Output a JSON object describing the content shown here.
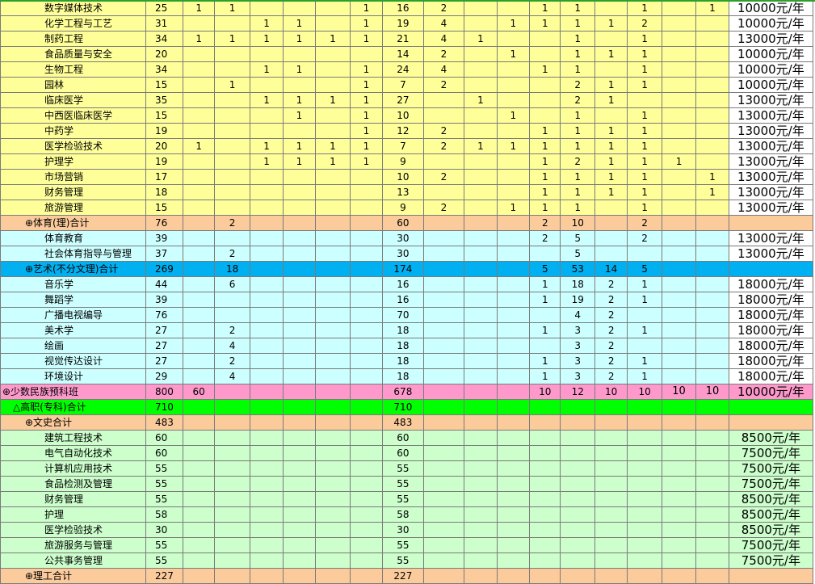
{
  "rows": [
    {
      "name": "数字媒体技术",
      "level": "item",
      "fill": "yellow",
      "cells": [
        "25",
        "1",
        "1",
        "",
        "",
        "",
        "1",
        "16",
        "2",
        "",
        "",
        "1",
        "1",
        "",
        "1",
        "",
        "1",
        "10000元/年"
      ],
      "fee_white": true
    },
    {
      "name": "化学工程与工艺",
      "level": "item",
      "fill": "yellow",
      "cells": [
        "31",
        "",
        "",
        "1",
        "1",
        "",
        "1",
        "19",
        "4",
        "",
        "1",
        "1",
        "1",
        "1",
        "2",
        "",
        "",
        "10000元/年"
      ],
      "fee_white": true
    },
    {
      "name": "制药工程",
      "level": "item",
      "fill": "yellow",
      "cells": [
        "34",
        "1",
        "1",
        "1",
        "1",
        "1",
        "1",
        "21",
        "4",
        "1",
        "",
        "",
        "1",
        "",
        "1",
        "",
        "",
        "13000元/年"
      ],
      "fee_white": true
    },
    {
      "name": "食品质量与安全",
      "level": "item",
      "fill": "yellow",
      "cells": [
        "20",
        "",
        "",
        "",
        "",
        "",
        "",
        "14",
        "2",
        "",
        "1",
        "",
        "1",
        "1",
        "1",
        "",
        "",
        "10000元/年"
      ],
      "fee_white": true
    },
    {
      "name": "生物工程",
      "level": "item",
      "fill": "yellow",
      "cells": [
        "34",
        "",
        "",
        "1",
        "1",
        "",
        "1",
        "24",
        "4",
        "",
        "",
        "1",
        "1",
        "",
        "1",
        "",
        "",
        "10000元/年"
      ],
      "fee_white": true
    },
    {
      "name": "园林",
      "level": "item",
      "fill": "yellow",
      "cells": [
        "15",
        "",
        "1",
        "",
        "",
        "",
        "1",
        "7",
        "2",
        "",
        "",
        "",
        "2",
        "1",
        "1",
        "",
        "",
        "10000元/年"
      ],
      "fee_white": true
    },
    {
      "name": "临床医学",
      "level": "item",
      "fill": "yellow",
      "cells": [
        "35",
        "",
        "",
        "1",
        "1",
        "1",
        "1",
        "27",
        "",
        "1",
        "",
        "",
        "2",
        "1",
        "",
        "",
        "",
        "13000元/年"
      ],
      "fee_white": true
    },
    {
      "name": "中西医临床医学",
      "level": "item",
      "fill": "yellow",
      "cells": [
        "15",
        "",
        "",
        "",
        "1",
        "",
        "1",
        "10",
        "",
        "",
        "1",
        "",
        "1",
        "",
        "1",
        "",
        "",
        "13000元/年"
      ],
      "fee_white": true
    },
    {
      "name": "中药学",
      "level": "item",
      "fill": "yellow",
      "cells": [
        "19",
        "",
        "",
        "",
        "",
        "",
        "1",
        "12",
        "2",
        "",
        "",
        "1",
        "1",
        "1",
        "1",
        "",
        "",
        "13000元/年"
      ],
      "fee_white": true
    },
    {
      "name": "医学检验技术",
      "level": "item",
      "fill": "yellow",
      "cells": [
        "20",
        "1",
        "",
        "1",
        "1",
        "1",
        "1",
        "7",
        "2",
        "1",
        "1",
        "1",
        "1",
        "1",
        "1",
        "",
        "",
        "13000元/年"
      ],
      "fee_white": true
    },
    {
      "name": "护理学",
      "level": "item",
      "fill": "yellow",
      "cells": [
        "19",
        "",
        "",
        "1",
        "1",
        "1",
        "1",
        "9",
        "",
        "",
        "",
        "1",
        "2",
        "1",
        "1",
        "1",
        "",
        "13000元/年"
      ],
      "fee_white": true
    },
    {
      "name": "市场营销",
      "level": "item",
      "fill": "yellow",
      "cells": [
        "17",
        "",
        "",
        "",
        "",
        "",
        "",
        "10",
        "2",
        "",
        "",
        "1",
        "1",
        "1",
        "1",
        "",
        "1",
        "13000元/年"
      ],
      "fee_white": true
    },
    {
      "name": "财务管理",
      "level": "item",
      "fill": "yellow",
      "cells": [
        "18",
        "",
        "",
        "",
        "",
        "",
        "",
        "13",
        "",
        "",
        "",
        "1",
        "1",
        "1",
        "1",
        "",
        "1",
        "13000元/年"
      ],
      "fee_white": true
    },
    {
      "name": "旅游管理",
      "level": "item",
      "fill": "yellow",
      "cells": [
        "15",
        "",
        "",
        "",
        "",
        "",
        "",
        "9",
        "2",
        "",
        "1",
        "1",
        "1",
        "",
        "1",
        "",
        "",
        "13000元/年"
      ],
      "fee_white": true
    },
    {
      "name": "⊕体育(理)合计",
      "level": "sub",
      "fill": "peach",
      "cells": [
        "76",
        "",
        "2",
        "",
        "",
        "",
        "",
        "60",
        "",
        "",
        "",
        "2",
        "10",
        "",
        "2",
        "",
        "",
        ""
      ],
      "fee_white": false
    },
    {
      "name": "体育教育",
      "level": "item",
      "fill": "cyan",
      "cells": [
        "39",
        "",
        "",
        "",
        "",
        "",
        "",
        "30",
        "",
        "",
        "",
        "2",
        "5",
        "",
        "2",
        "",
        "",
        "13000元/年"
      ],
      "fee_white": true
    },
    {
      "name": "社会体育指导与管理",
      "level": "item",
      "fill": "cyan",
      "cells": [
        "37",
        "",
        "2",
        "",
        "",
        "",
        "",
        "30",
        "",
        "",
        "",
        "",
        "5",
        "",
        "",
        "",
        "",
        "13000元/年"
      ],
      "fee_white": true
    },
    {
      "name": "⊕艺术(不分文理)合计",
      "level": "sub",
      "fill": "blue",
      "cells": [
        "269",
        "",
        "18",
        "",
        "",
        "",
        "",
        "174",
        "",
        "",
        "",
        "5",
        "53",
        "14",
        "5",
        "",
        "",
        ""
      ],
      "fee_white": false
    },
    {
      "name": "音乐学",
      "level": "item",
      "fill": "cyan",
      "cells": [
        "44",
        "",
        "6",
        "",
        "",
        "",
        "",
        "16",
        "",
        "",
        "",
        "1",
        "18",
        "2",
        "1",
        "",
        "",
        "18000元/年"
      ],
      "fee_white": true
    },
    {
      "name": "舞蹈学",
      "level": "item",
      "fill": "cyan",
      "cells": [
        "39",
        "",
        "",
        "",
        "",
        "",
        "",
        "16",
        "",
        "",
        "",
        "1",
        "19",
        "2",
        "1",
        "",
        "",
        "18000元/年"
      ],
      "fee_white": true
    },
    {
      "name": "广播电视编导",
      "level": "item",
      "fill": "cyan",
      "cells": [
        "76",
        "",
        "",
        "",
        "",
        "",
        "",
        "70",
        "",
        "",
        "",
        "",
        "4",
        "2",
        "",
        "",
        "",
        "18000元/年"
      ],
      "fee_white": true
    },
    {
      "name": "美术学",
      "level": "item",
      "fill": "cyan",
      "cells": [
        "27",
        "",
        "2",
        "",
        "",
        "",
        "",
        "18",
        "",
        "",
        "",
        "1",
        "3",
        "2",
        "1",
        "",
        "",
        "18000元/年"
      ],
      "fee_white": true
    },
    {
      "name": "绘画",
      "level": "item",
      "fill": "cyan",
      "cells": [
        "27",
        "",
        "4",
        "",
        "",
        "",
        "",
        "18",
        "",
        "",
        "",
        "",
        "3",
        "2",
        "",
        "",
        "",
        "18000元/年"
      ],
      "fee_white": true
    },
    {
      "name": "视觉传达设计",
      "level": "item",
      "fill": "cyan",
      "cells": [
        "27",
        "",
        "2",
        "",
        "",
        "",
        "",
        "18",
        "",
        "",
        "",
        "1",
        "3",
        "2",
        "1",
        "",
        "",
        "18000元/年"
      ],
      "fee_white": true
    },
    {
      "name": "环境设计",
      "level": "item",
      "fill": "cyan",
      "cells": [
        "29",
        "",
        "4",
        "",
        "",
        "",
        "",
        "18",
        "",
        "",
        "",
        "1",
        "3",
        "2",
        "1",
        "",
        "",
        "18000元/年"
      ],
      "fee_white": true
    },
    {
      "name": "⊕少数民族预科班",
      "level": "top",
      "fill": "pink",
      "cells": [
        "800",
        "60",
        "",
        "",
        "",
        "",
        "",
        "678",
        "",
        "",
        "",
        "10",
        "12",
        "10",
        "10",
        "10",
        "10",
        "10000元/年"
      ],
      "fee_white": false
    },
    {
      "name": "△高职(专科)合计",
      "level": "mid",
      "fill": "green",
      "cells": [
        "710",
        "",
        "",
        "",
        "",
        "",
        "",
        "710",
        "",
        "",
        "",
        "",
        "",
        "",
        "",
        "",
        "",
        ""
      ],
      "fee_white": false
    },
    {
      "name": "⊕文史合计",
      "level": "sub",
      "fill": "peach",
      "cells": [
        "483",
        "",
        "",
        "",
        "",
        "",
        "",
        "483",
        "",
        "",
        "",
        "",
        "",
        "",
        "",
        "",
        "",
        ""
      ],
      "fee_white": false
    },
    {
      "name": "建筑工程技术",
      "level": "item",
      "fill": "mint",
      "cells": [
        "60",
        "",
        "",
        "",
        "",
        "",
        "",
        "60",
        "",
        "",
        "",
        "",
        "",
        "",
        "",
        "",
        "",
        "8500元/年"
      ],
      "fee_white": false
    },
    {
      "name": "电气自动化技术",
      "level": "item",
      "fill": "mint",
      "cells": [
        "60",
        "",
        "",
        "",
        "",
        "",
        "",
        "60",
        "",
        "",
        "",
        "",
        "",
        "",
        "",
        "",
        "",
        "7500元/年"
      ],
      "fee_white": false
    },
    {
      "name": "计算机应用技术",
      "level": "item",
      "fill": "mint",
      "cells": [
        "55",
        "",
        "",
        "",
        "",
        "",
        "",
        "55",
        "",
        "",
        "",
        "",
        "",
        "",
        "",
        "",
        "",
        "7500元/年"
      ],
      "fee_white": false
    },
    {
      "name": "食品检测及管理",
      "level": "item",
      "fill": "mint",
      "cells": [
        "55",
        "",
        "",
        "",
        "",
        "",
        "",
        "55",
        "",
        "",
        "",
        "",
        "",
        "",
        "",
        "",
        "",
        "7500元/年"
      ],
      "fee_white": false
    },
    {
      "name": "财务管理",
      "level": "item",
      "fill": "mint",
      "cells": [
        "55",
        "",
        "",
        "",
        "",
        "",
        "",
        "55",
        "",
        "",
        "",
        "",
        "",
        "",
        "",
        "",
        "",
        "8500元/年"
      ],
      "fee_white": false
    },
    {
      "name": "护理",
      "level": "item",
      "fill": "mint",
      "cells": [
        "58",
        "",
        "",
        "",
        "",
        "",
        "",
        "58",
        "",
        "",
        "",
        "",
        "",
        "",
        "",
        "",
        "",
        "8500元/年"
      ],
      "fee_white": false
    },
    {
      "name": "医学检验技术",
      "level": "item",
      "fill": "mint",
      "cells": [
        "30",
        "",
        "",
        "",
        "",
        "",
        "",
        "30",
        "",
        "",
        "",
        "",
        "",
        "",
        "",
        "",
        "",
        "8500元/年"
      ],
      "fee_white": false
    },
    {
      "name": "旅游服务与管理",
      "level": "item",
      "fill": "mint",
      "cells": [
        "55",
        "",
        "",
        "",
        "",
        "",
        "",
        "55",
        "",
        "",
        "",
        "",
        "",
        "",
        "",
        "",
        "",
        "7500元/年"
      ],
      "fee_white": false
    },
    {
      "name": "公共事务管理",
      "level": "item",
      "fill": "mint",
      "cells": [
        "55",
        "",
        "",
        "",
        "",
        "",
        "",
        "55",
        "",
        "",
        "",
        "",
        "",
        "",
        "",
        "",
        "",
        "7500元/年"
      ],
      "fee_white": false
    },
    {
      "name": "⊕理工合计",
      "level": "sub",
      "fill": "peach",
      "cells": [
        "227",
        "",
        "",
        "",
        "",
        "",
        "",
        "227",
        "",
        "",
        "",
        "",
        "",
        "",
        "",
        "",
        "",
        ""
      ],
      "fee_white": false
    }
  ]
}
